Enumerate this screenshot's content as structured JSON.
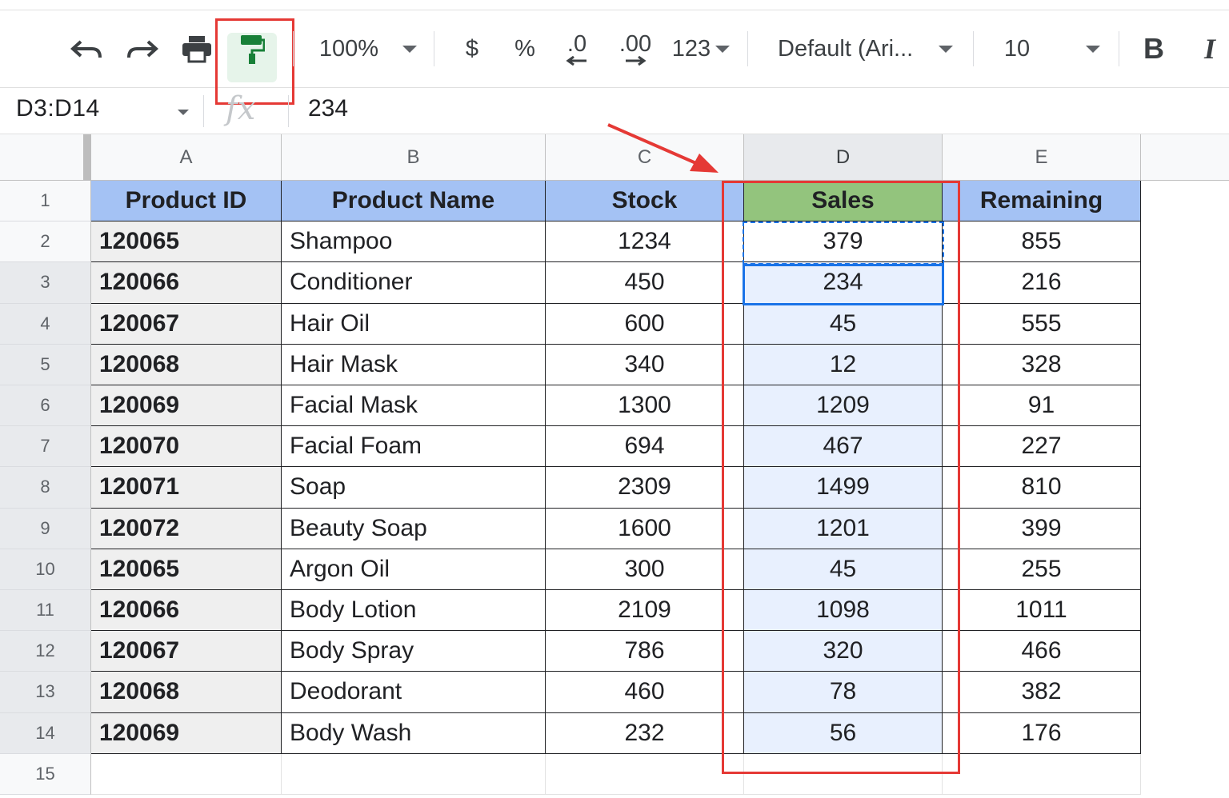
{
  "toolbar": {
    "zoom": "100%",
    "currency": "$",
    "percent": "%",
    "decrease_decimal": ".0",
    "increase_decimal": ".00",
    "number_format": "123",
    "font": "Default (Ari...",
    "font_size": "10",
    "bold": "B",
    "italic": "I",
    "highlight_color": "#e53935",
    "paint_format_color": "#188038"
  },
  "formula_bar": {
    "name_box": "D3:D14",
    "fx": "fx",
    "value": "234"
  },
  "columns": [
    "A",
    "B",
    "C",
    "D",
    "E"
  ],
  "selected_column": "D",
  "rows": [
    "1",
    "2",
    "3",
    "4",
    "5",
    "6",
    "7",
    "8",
    "9",
    "10",
    "11",
    "12",
    "13",
    "14",
    "15"
  ],
  "table": {
    "headers": [
      "Product ID",
      "Product Name",
      "Stock",
      "Sales",
      "Remaining"
    ],
    "data": [
      [
        "120065",
        "Shampoo",
        "1234",
        "379",
        "855"
      ],
      [
        "120066",
        "Conditioner",
        "450",
        "234",
        "216"
      ],
      [
        "120067",
        "Hair Oil",
        "600",
        "45",
        "555"
      ],
      [
        "120068",
        "Hair Mask",
        "340",
        "12",
        "328"
      ],
      [
        "120069",
        "Facial Mask",
        "1300",
        "1209",
        "91"
      ],
      [
        "120070",
        "Facial Foam",
        "694",
        "467",
        "227"
      ],
      [
        "120071",
        "Soap",
        "2309",
        "1499",
        "810"
      ],
      [
        "120072",
        "Beauty Soap",
        "1600",
        "1201",
        "399"
      ],
      [
        "120065",
        "Argon Oil",
        "300",
        "45",
        "255"
      ],
      [
        "120066",
        "Body Lotion",
        "2109",
        "1098",
        "1011"
      ],
      [
        "120067",
        "Body Spray",
        "786",
        "320",
        "466"
      ],
      [
        "120068",
        "Deodorant",
        "460",
        "78",
        "382"
      ],
      [
        "120069",
        "Body Wash",
        "232",
        "56",
        "176"
      ]
    ]
  },
  "colors": {
    "header_fill": "#a4c2f4",
    "sales_header_fill": "#93c47d",
    "id_column_fill": "#efefef",
    "selection_fill": "#e8f0fe",
    "selection_border": "#1a73e8"
  }
}
